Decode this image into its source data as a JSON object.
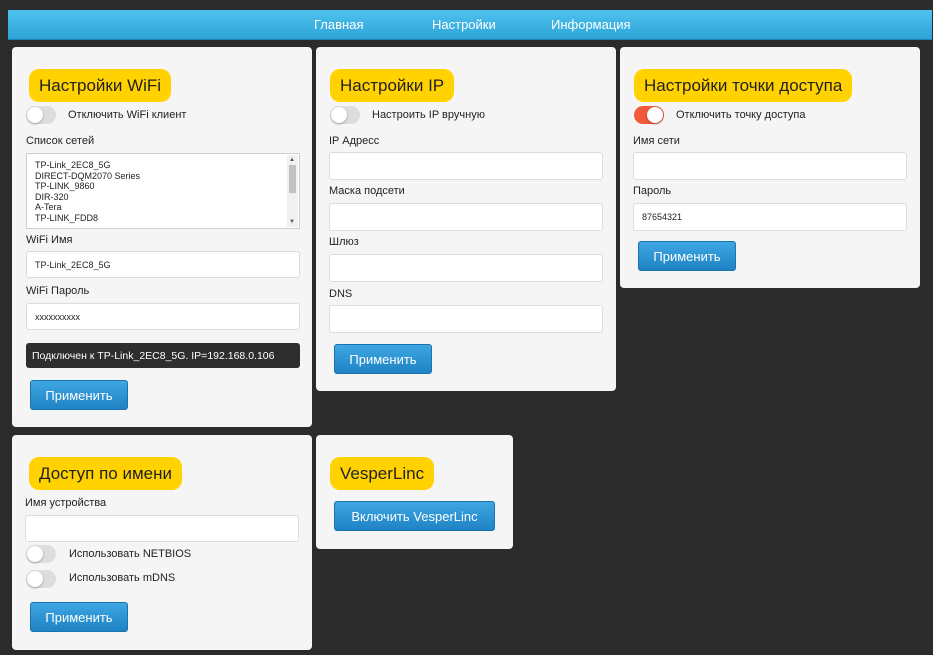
{
  "nav": {
    "home": "Главная",
    "settings": "Настройки",
    "info": "Информация"
  },
  "wifi": {
    "title": "Настройки WiFi",
    "disable_client_label": "Отключить WiFi клиент",
    "disable_client_on": false,
    "networks_label": "Список сетей",
    "networks": [
      "TP-Link_2EC8_5G",
      "DIRECT-DQM2070 Series",
      "TP-LINK_9860",
      "DIR-320",
      "A-Tera",
      "TP-LINK_FDD8"
    ],
    "name_label": "WiFi Имя",
    "name_value": "TP-Link_2EC8_5G",
    "password_label": "WiFi Пароль",
    "password_value": "xxxxxxxxxx",
    "status": "Подключен к TP-Link_2EC8_5G. IP=192.168.0.106",
    "apply": "Применить"
  },
  "ip": {
    "title": "Настройки IP",
    "manual_label": "Настроить IP вручную",
    "manual_on": false,
    "address_label": "IP Адресс",
    "address_value": "",
    "mask_label": "Маска подсети",
    "mask_value": "",
    "gateway_label": "Шлюз",
    "gateway_value": "",
    "dns_label": "DNS",
    "dns_value": "",
    "apply": "Применить"
  },
  "ap": {
    "title": "Настройки точки доступа",
    "disable_label": "Отключить точку доступа",
    "disable_on": true,
    "ssid_label": "Имя сети",
    "ssid_value": "",
    "password_label": "Пароль",
    "password_value": "87654321",
    "apply": "Применить"
  },
  "name_access": {
    "title": "Доступ по имени",
    "device_label": "Имя устройства",
    "device_value": "",
    "netbios_label": "Использовать NETBIOS",
    "netbios_on": false,
    "mdns_label": "Использовать mDNS",
    "mdns_on": false,
    "apply": "Применить"
  },
  "vesper": {
    "title": "VesperLinc",
    "enable": "Включить VesperLinc"
  },
  "colors": {
    "accent_yellow": "#ffd200",
    "button_blue": "#1f82c4",
    "toggle_on": "#ef5a3a",
    "background": "#2b2b2b"
  }
}
